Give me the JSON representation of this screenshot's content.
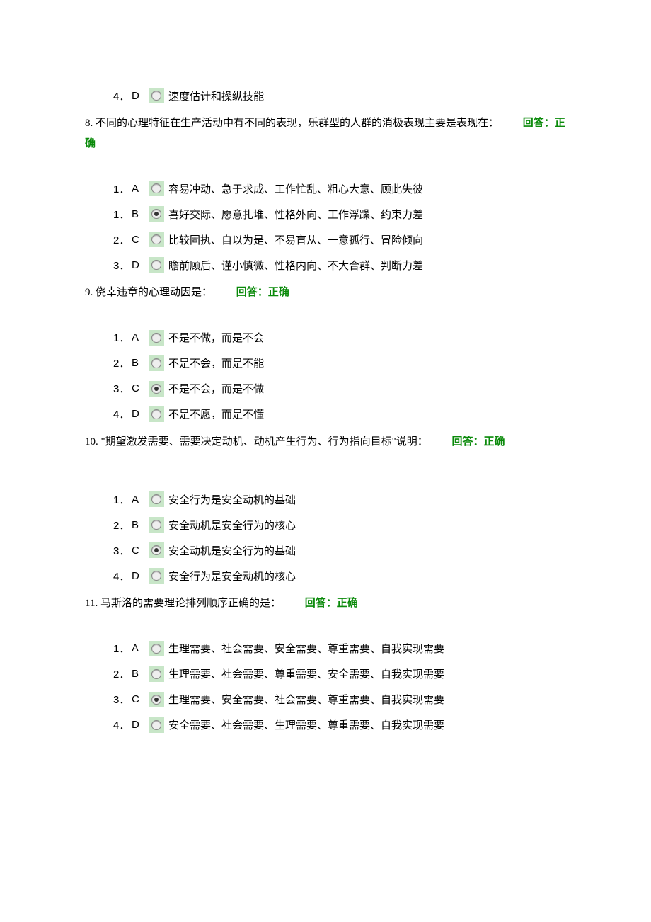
{
  "orphan_option": {
    "num": "4．",
    "letter": "D",
    "text": "速度估计和操纵技能",
    "selected": false
  },
  "questions": [
    {
      "id": "q8",
      "number": "8.",
      "text": " 不同的心理特征在生产活动中有不同的表现，乐群型的人群的消极表现主要是表现在：",
      "feedback": "回答：正确",
      "options": [
        {
          "num": "1．",
          "letter": "A",
          "text": "容易冲动、急于求成、工作忙乱、粗心大意、顾此失彼",
          "selected": false
        },
        {
          "num": "1．",
          "letter": "B",
          "text": "喜好交际、愿意扎堆、性格外向、工作浮躁、约束力差",
          "selected": true
        },
        {
          "num": "2．",
          "letter": "C",
          "text": "比较固执、自以为是、不易盲从、一意孤行、冒险倾向",
          "selected": false
        },
        {
          "num": "3．",
          "letter": "D",
          "text": "瞻前顾后、谨小慎微、性格内向、不大合群、判断力差",
          "selected": false
        }
      ]
    },
    {
      "id": "q9",
      "number": "9.",
      "text": " 侥幸违章的心理动因是：",
      "feedback": "回答：正确",
      "options": [
        {
          "num": "1．",
          "letter": "A",
          "text": "不是不做，而是不会",
          "selected": false
        },
        {
          "num": "2．",
          "letter": "B",
          "text": "不是不会，而是不能",
          "selected": false
        },
        {
          "num": "3．",
          "letter": "C",
          "text": "不是不会，而是不做",
          "selected": true
        },
        {
          "num": "4．",
          "letter": "D",
          "text": "不是不愿，而是不懂",
          "selected": false
        }
      ]
    },
    {
      "id": "q10",
      "number": "10.",
      "text": " \"期望激发需要、需要决定动机、动机产生行为、行为指向目标\"说明：",
      "feedback": "回答：正确",
      "options": [
        {
          "num": "1．",
          "letter": "A",
          "text": "安全行为是安全动机的基础",
          "selected": false
        },
        {
          "num": "2．",
          "letter": "B",
          "text": "安全动机是安全行为的核心",
          "selected": false
        },
        {
          "num": "3．",
          "letter": "C",
          "text": "安全动机是安全行为的基础",
          "selected": true
        },
        {
          "num": "4．",
          "letter": "D",
          "text": "安全行为是安全动机的核心",
          "selected": false
        }
      ]
    },
    {
      "id": "q11",
      "number": "11.",
      "text": " 马斯洛的需要理论排列顺序正确的是：",
      "feedback": "回答：正确",
      "options": [
        {
          "num": "1．",
          "letter": "A",
          "text": "生理需要、社会需要、安全需要、尊重需要、自我实现需要",
          "selected": false
        },
        {
          "num": "2．",
          "letter": "B",
          "text": "生理需要、社会需要、尊重需要、安全需要、自我实现需要",
          "selected": false
        },
        {
          "num": "3．",
          "letter": "C",
          "text": "生理需要、安全需要、社会需要、尊重需要、自我实现需要",
          "selected": true
        },
        {
          "num": "4．",
          "letter": "D",
          "text": "安全需要、社会需要、生理需要、尊重需要、自我实现需要",
          "selected": false
        }
      ]
    }
  ]
}
